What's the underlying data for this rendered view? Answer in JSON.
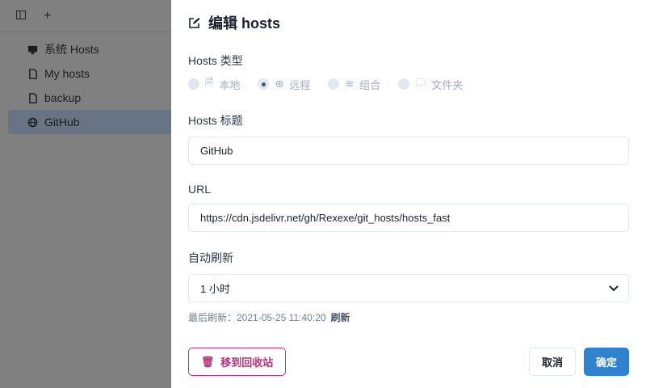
{
  "sidebar": {
    "items": [
      {
        "label": "系统 Hosts",
        "icon": "monitor-icon"
      },
      {
        "label": "My hosts",
        "icon": "file-icon"
      },
      {
        "label": "backup",
        "icon": "file-icon"
      },
      {
        "label": "GitHub",
        "icon": "globe-icon",
        "selected": true
      }
    ]
  },
  "drawer": {
    "title": "编辑 hosts",
    "type_label": "Hosts 类型",
    "types": [
      {
        "label": "本地",
        "icon": "file-icon"
      },
      {
        "label": "远程",
        "icon": "globe-icon",
        "selected": true
      },
      {
        "label": "组合",
        "icon": "layers-icon"
      },
      {
        "label": "文件夹",
        "icon": "folder-icon"
      }
    ],
    "title_label": "Hosts 标题",
    "title_value": "GitHub",
    "url_label": "URL",
    "url_value": "https://cdn.jsdelivr.net/gh/Rexexe/git_hosts/hosts_fast",
    "refresh_label": "自动刷新",
    "refresh_value": "1 小时",
    "last_refresh": "最后刷新：2021-05-25 11:40:20",
    "refresh_link": "刷新",
    "trash_button": "移到回收站",
    "cancel_button": "取消",
    "ok_button": "确定"
  },
  "colors": {
    "accent": "#3182ce",
    "danger": "#b83280"
  }
}
